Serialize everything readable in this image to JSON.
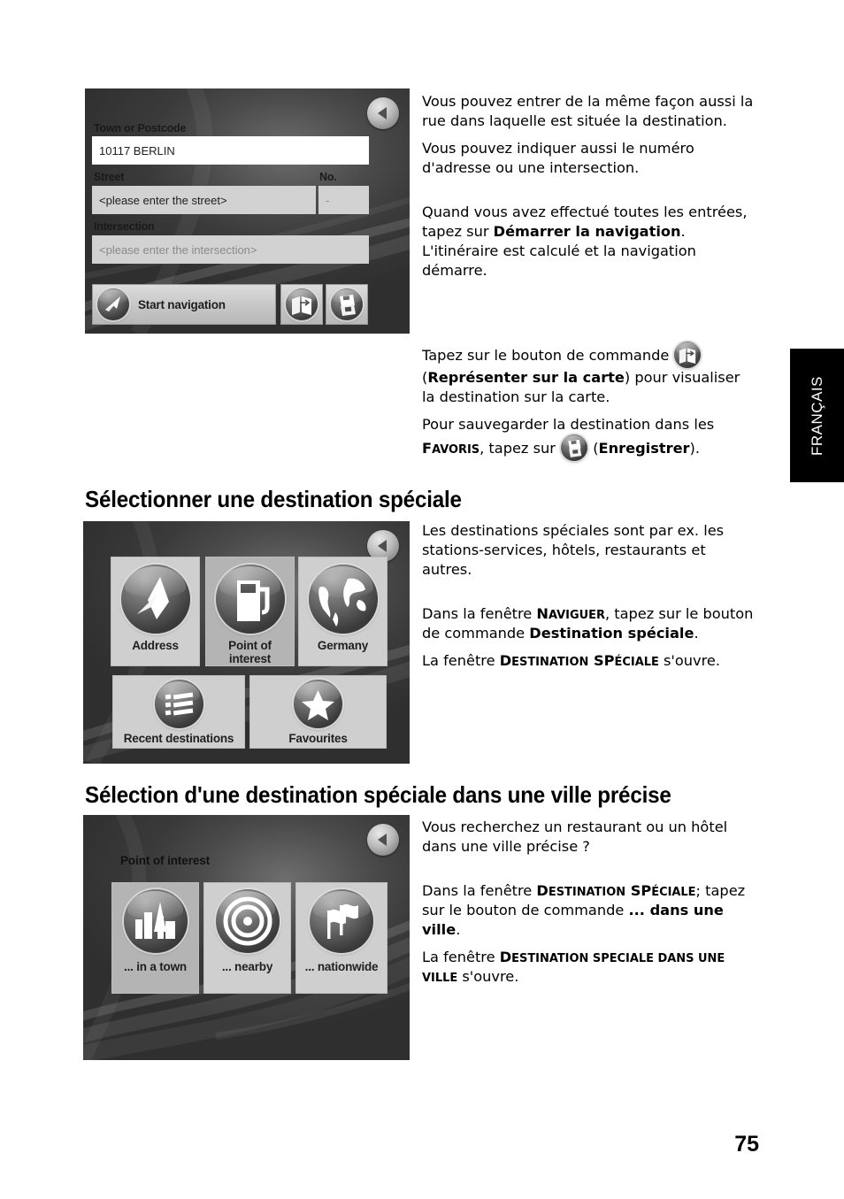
{
  "page": {
    "number": "75",
    "language_tab": "FRANÇAIS"
  },
  "headings": {
    "special_destination": "Sélectionner une destination spéciale",
    "special_in_town": "Sélection d'une destination spéciale dans une ville précise"
  },
  "text_blocks": {
    "block1": {
      "p1": "Vous pouvez entrer de la même façon aussi la rue dans laquelle est située la destination.",
      "p2": "Vous pouvez indiquer aussi le numéro d'adresse ou une intersection.",
      "p3_before": "Quand vous avez effectué toutes les entrées, tapez sur ",
      "p3_bold": "Démarrer la navigation",
      "p3_after": ". L'itinéraire est calculé et la navigation démarre."
    },
    "block2": {
      "p1_before": "Tapez sur le bouton de commande ",
      "p1_mid": " (",
      "p1_bold": "Représenter sur la carte",
      "p1_after": ") pour visualiser la destination sur la carte.",
      "p2_before": "Pour sauvegarder la destination dans les ",
      "p2_sc_cap": "F",
      "p2_sc_rest": "AVORIS",
      "p2_mid": ", tapez sur ",
      "p2_paren_open": " (",
      "p2_bold": "Enregistrer",
      "p2_after": ")."
    },
    "block3": {
      "p1": "Les destinations spéciales sont par ex. les stations-services, hôtels, restaurants et autres.",
      "p2_before": "Dans la fenêtre ",
      "p2_sc_cap": "N",
      "p2_sc_rest": "AVIGUER",
      "p2_mid": ", tapez sur le bouton de commande ",
      "p2_bold": "Destination spéciale",
      "p2_after": ".",
      "p3_before": "La fenêtre ",
      "p3_sc_cap": "D",
      "p3_sc_rest": "ESTINATION",
      "p3_sc_cap2": " SP",
      "p3_sc_rest2": "ÉCIALE",
      "p3_after": " s'ouvre."
    },
    "block4": {
      "p1": "Vous recherchez un restaurant ou un hôtel dans une ville précise ?",
      "p2_before": "Dans la fenêtre ",
      "p2_sc_cap": "D",
      "p2_sc_rest": "ESTINATION",
      "p2_sc_cap2": " SP",
      "p2_sc_rest2": "ÉCIALE",
      "p2_mid": "; tapez sur le bouton de commande ",
      "p2_bold": "... dans une ville",
      "p2_after": ".",
      "p3_before": "La fenêtre ",
      "p3_sc_cap": "D",
      "p3_sc_rest": "ESTINATION",
      "p3_sc_cap2": " SPECIALE",
      "p3_sc_rest2": " DANS",
      "p3_sc_cap3": " UNE",
      "p3_sc_rest3": " VILLE",
      "p3_after": " s'ouvre."
    }
  },
  "device_address": {
    "label_town": "Town or Postcode",
    "value_town": "10117 BERLIN",
    "label_street": "Street",
    "label_no": "No.",
    "value_street": "<please enter the street>",
    "value_no": "-",
    "label_intersection": "Intersection",
    "value_intersection": "<please enter the intersection>",
    "start_navigation": "Start navigation",
    "icon_map": "show-on-map-icon",
    "icon_save": "save-icon",
    "icon_back": "back-arrow-icon"
  },
  "device_navigate": {
    "tiles": [
      {
        "label": "Address",
        "icon": "compass-needle-icon"
      },
      {
        "label": "Point of interest",
        "icon": "fuel-pump-icon"
      },
      {
        "label": "Germany",
        "icon": "globe-icon"
      },
      {
        "label": "Recent destinations",
        "icon": "list-icon"
      },
      {
        "label": "Favourites",
        "icon": "star-icon"
      }
    ],
    "icon_back": "back-arrow-icon"
  },
  "device_poi": {
    "title": "Point of interest",
    "tiles": [
      {
        "label": "... in a town",
        "icon": "city-buildings-icon"
      },
      {
        "label": "... nearby",
        "icon": "target-rings-icon"
      },
      {
        "label": "... nationwide",
        "icon": "flags-icon"
      }
    ],
    "icon_back": "back-arrow-icon"
  }
}
